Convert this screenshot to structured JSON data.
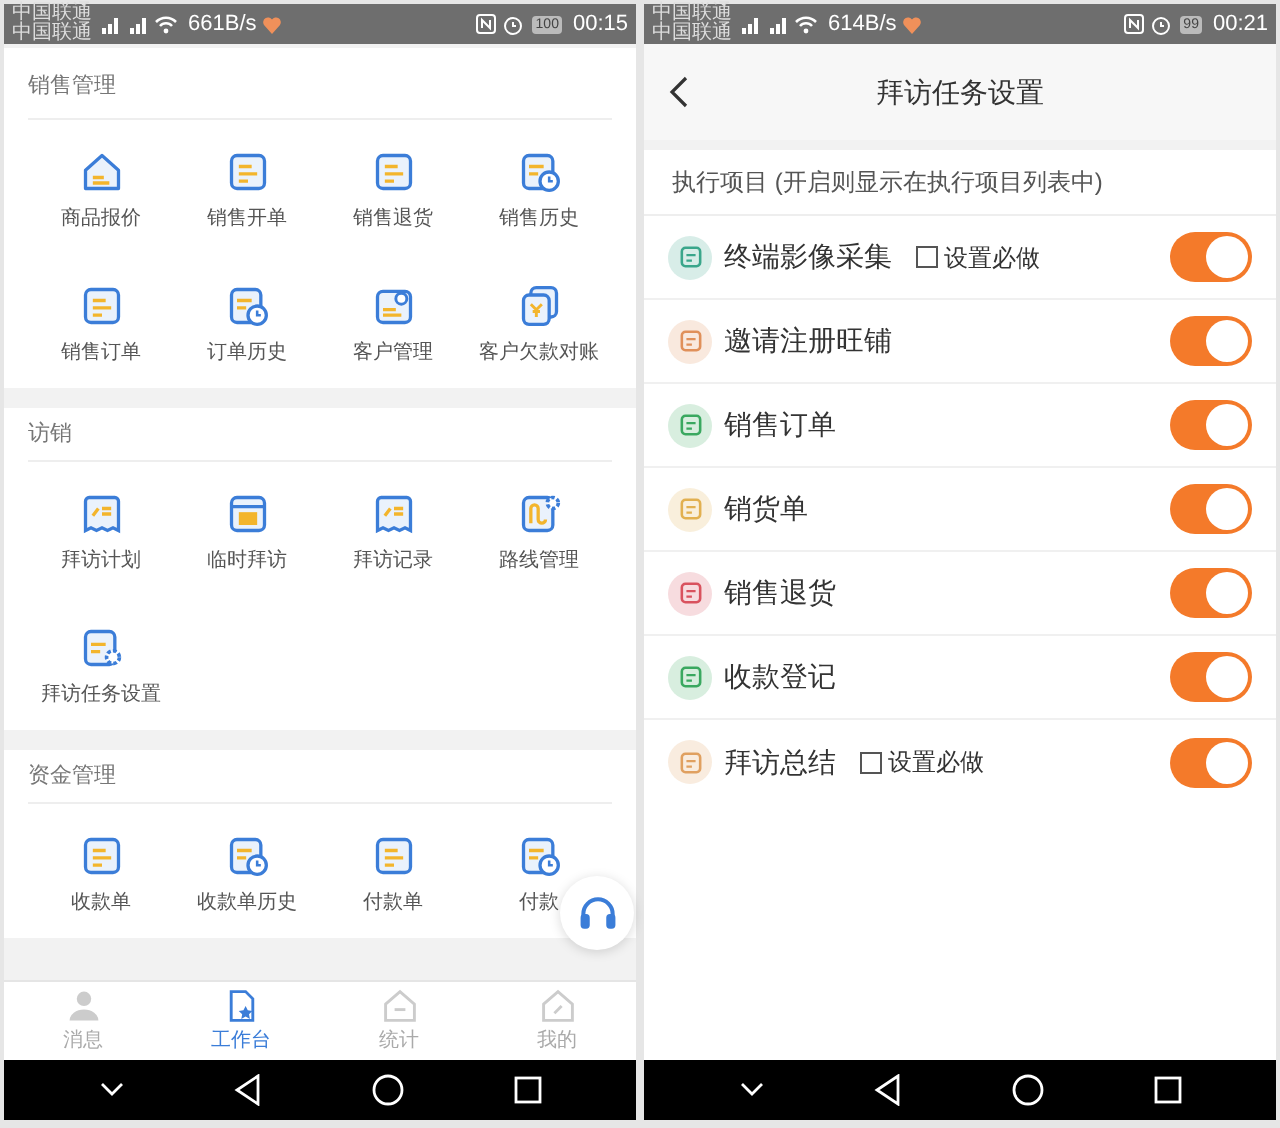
{
  "left_screen": {
    "status_bar": {
      "carriers": [
        "中国联通",
        "中国联通"
      ],
      "network_speed": "661B/s",
      "battery": "100",
      "time": "00:15"
    },
    "sections": [
      {
        "title": "销售管理",
        "items": [
          {
            "label": "商品报价"
          },
          {
            "label": "销售开单"
          },
          {
            "label": "销售退货"
          },
          {
            "label": "销售历史"
          },
          {
            "label": "销售订单"
          },
          {
            "label": "订单历史"
          },
          {
            "label": "客户管理"
          },
          {
            "label": "客户欠款对账"
          }
        ]
      },
      {
        "title": "访销",
        "items": [
          {
            "label": "拜访计划"
          },
          {
            "label": "临时拜访"
          },
          {
            "label": "拜访记录"
          },
          {
            "label": "路线管理"
          },
          {
            "label": "拜访任务设置"
          }
        ]
      },
      {
        "title": "资金管理",
        "items": [
          {
            "label": "收款单"
          },
          {
            "label": "收款单历史"
          },
          {
            "label": "付款单"
          },
          {
            "label": "付款"
          }
        ]
      }
    ],
    "tab_bar": [
      {
        "label": "消息",
        "selected": false
      },
      {
        "label": "工作台",
        "selected": true
      },
      {
        "label": "统计",
        "selected": false
      },
      {
        "label": "我的",
        "selected": false
      }
    ]
  },
  "right_screen": {
    "status_bar": {
      "carriers": [
        "中国联通",
        "中国联通"
      ],
      "network_speed": "614B/s",
      "battery": "99",
      "time": "00:21"
    },
    "title": "拜访任务设置",
    "section_label": "执行项目 (开启则显示在执行项目列表中)",
    "tasks": [
      {
        "label": "终端影像采集",
        "color": "#3aa68b",
        "required": {
          "label": "设置必做",
          "checked": false
        },
        "on": true
      },
      {
        "label": "邀请注册旺铺",
        "color": "#e0905a",
        "on": true
      },
      {
        "label": "销售订单",
        "color": "#3aa860",
        "on": true
      },
      {
        "label": "销货单",
        "color": "#e2b050",
        "on": true
      },
      {
        "label": "销售退货",
        "color": "#d9525e",
        "on": true
      },
      {
        "label": "收款登记",
        "color": "#3aa860",
        "on": true
      },
      {
        "label": "拜访总结",
        "color": "#e0a060",
        "required": {
          "label": "设置必做",
          "checked": false
        },
        "on": true
      }
    ]
  }
}
